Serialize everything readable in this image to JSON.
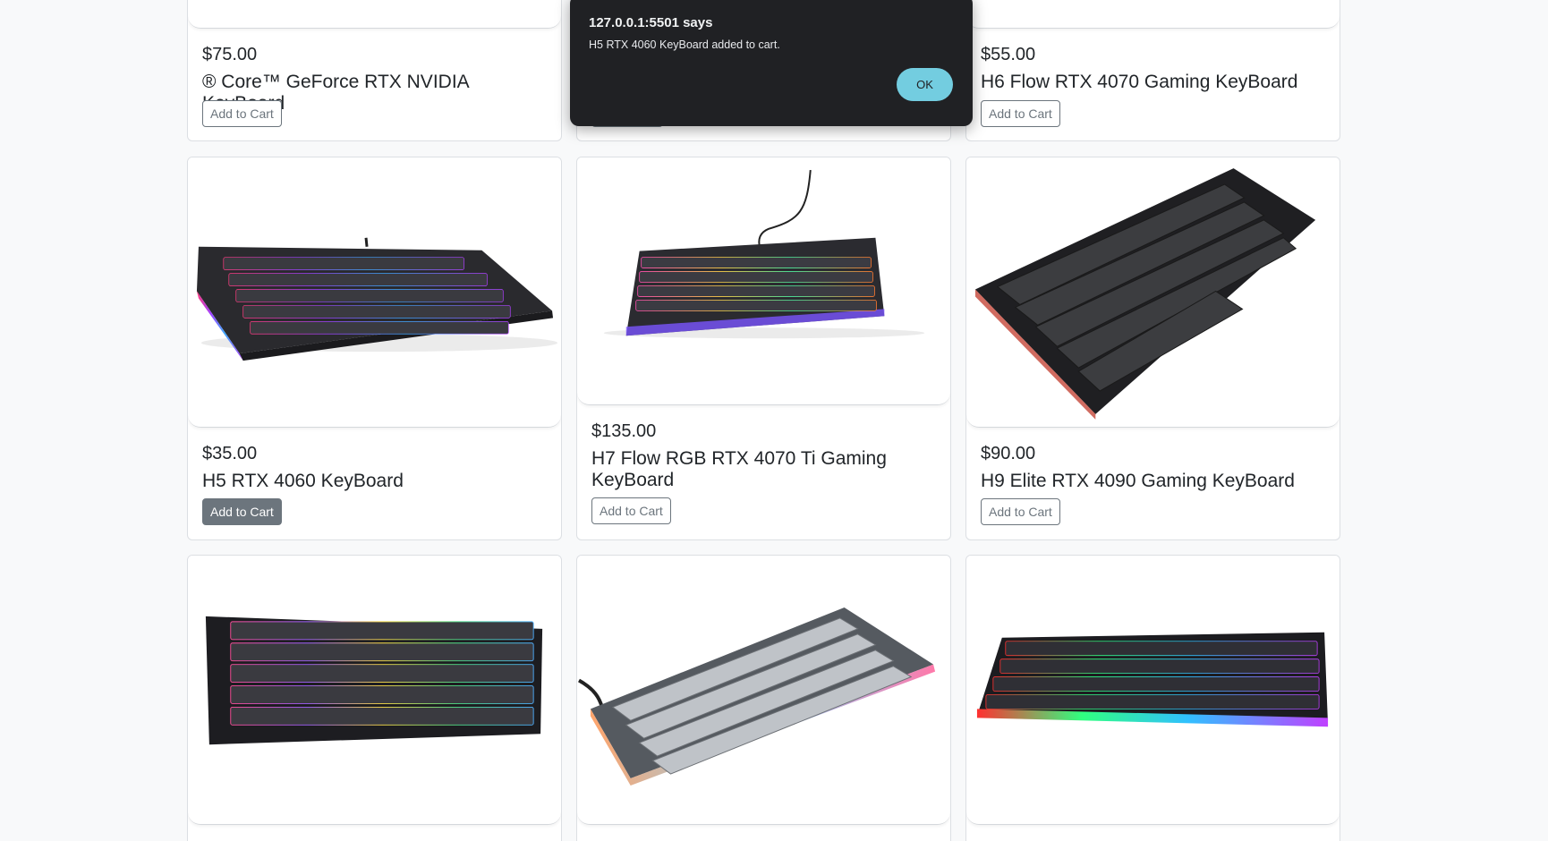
{
  "dialog": {
    "title": "127.0.0.1:5501 says",
    "message": "H5 RTX 4060 KeyBoard added to cart.",
    "ok_label": "OK"
  },
  "products": [
    {
      "price": "$75.00",
      "name": "® Core™ GeForce RTX NVIDIA KeyBoard",
      "button": "Add to Cart"
    },
    {
      "price": "",
      "name": "",
      "button": ""
    },
    {
      "price": "$55.00",
      "name": "H6 Flow RTX 4070 Gaming KeyBoard",
      "button": "Add to Cart"
    },
    {
      "price": "$35.00",
      "name": "H5 RTX 4060 KeyBoard",
      "button": "Add to Cart"
    },
    {
      "price": "$135.00",
      "name": "H7 Flow RGB RTX 4070 Ti Gaming KeyBoard",
      "button": "Add to Cart"
    },
    {
      "price": "$90.00",
      "name": "H9 Elite RTX 4090 Gaming KeyBoard",
      "button": "Add to Cart"
    }
  ],
  "product_images": [
    {
      "icon": "keyboard-full-size-rgb-image"
    },
    {
      "icon": "keyboard-tkl-rgb-cable-image"
    },
    {
      "icon": "keyboard-60-percent-image"
    },
    {
      "icon": "keyboard-60-percent-rgb-image"
    },
    {
      "icon": "keyboard-compact-gray-image"
    },
    {
      "icon": "keyboard-60-percent-rgb-side-image"
    }
  ],
  "colors": {
    "page_bg": "#f8f9fa",
    "button_border": "#6c757d",
    "dialog_bg": "#202124",
    "dialog_ok": "#73cde0"
  }
}
